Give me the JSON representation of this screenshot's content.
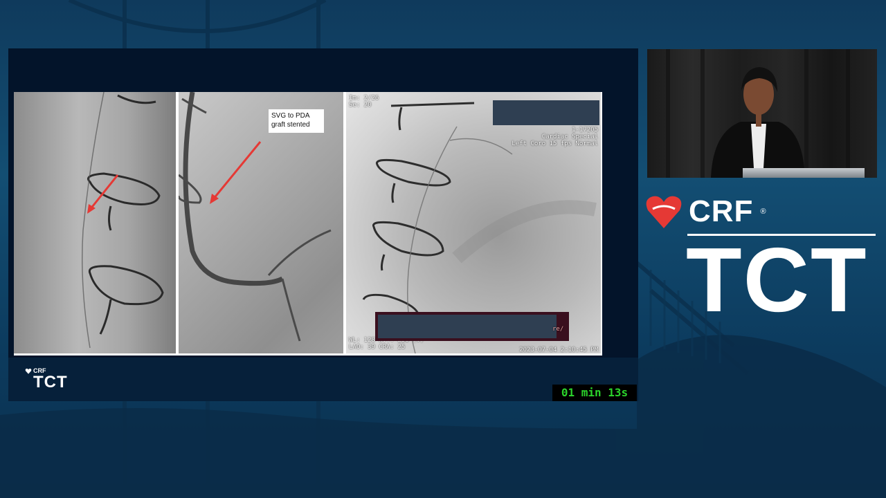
{
  "slide": {
    "annotation": "SVG to PDA graft stented",
    "angio_overlay": {
      "top_left": "Im: 2/26\nSe: 20",
      "top_right": "1-17205\nCardiac Special\nLeft Coro 15 fps Normal",
      "bottom_left": "WL: 128 W... 256 (V)\nLAO: 39 CRA: 25",
      "bottom_right": "2023-07-04 2:10:45 PM",
      "partial_link": "re/"
    },
    "logo": {
      "crf": "CRF",
      "tct": "TCT"
    },
    "timer": "01 min 13s"
  },
  "brand": {
    "crf": "CRF",
    "registered": "®",
    "tct": "TCT"
  },
  "colors": {
    "accent_red": "#e53935",
    "timer_green": "#2bd32b",
    "background": "#134e73"
  },
  "icons": [
    "crf-heart-icon",
    "red-arrow-icon"
  ]
}
